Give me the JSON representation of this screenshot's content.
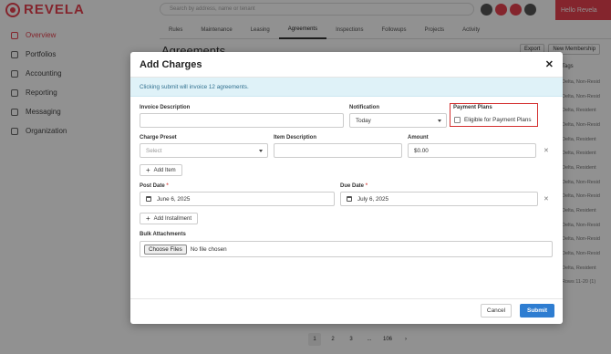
{
  "app": {
    "logo_text": "REVELA",
    "search_placeholder": "Search by address, name or tenant",
    "hello": "Hello Revela"
  },
  "sidebar": {
    "items": [
      {
        "label": "Overview",
        "active": true
      },
      {
        "label": "Portfolios"
      },
      {
        "label": "Accounting"
      },
      {
        "label": "Reporting"
      },
      {
        "label": "Messaging"
      },
      {
        "label": "Organization"
      }
    ]
  },
  "tabs": [
    "Rules",
    "Maintenance",
    "Leasing",
    "Agreements",
    "Inspections",
    "Followups",
    "Projects",
    "Activity"
  ],
  "background": {
    "page_title": "Agreements",
    "btn_export": "Export",
    "btn_new": "New Membership",
    "col_header": "Tags",
    "rows": [
      "Delta, Non-Resid",
      "Delta, Non-Resid",
      "Delta, Resident",
      "Delta, Non-Resid",
      "Delta, Resident",
      "Delta, Resident",
      "Delta, Resident",
      "Delta, Non-Resid",
      "Delta, Non-Resid",
      "Delta, Resident",
      "Delta, Non-Resid",
      "Delta, Non-Resid",
      "Delta, Non-Resid",
      "Delta, Resident"
    ],
    "pager": [
      "1",
      "2",
      "3",
      "...",
      "106"
    ],
    "showing": "Rows 11-20 (1)"
  },
  "modal": {
    "title": "Add Charges",
    "alert": "Clicking submit will invoice 12 agreements.",
    "invoice_description_label": "Invoice Description",
    "invoice_description_value": "",
    "notification_label": "Notification",
    "notification_value": "Today",
    "payment_plans_label": "Payment Plans",
    "payment_plans_checkbox": "Eligible for Payment Plans",
    "charge_preset_label": "Charge Preset",
    "charge_preset_placeholder": "Select",
    "item_description_label": "Item Description",
    "item_description_value": "",
    "amount_label": "Amount",
    "amount_value": "$0.00",
    "add_item": "Add Item",
    "post_date_label": "Post Date",
    "post_date_value": "June 6, 2025",
    "due_date_label": "Due Date",
    "due_date_value": "July 6, 2025",
    "add_installment": "Add Installment",
    "bulk_attachments_label": "Bulk Attachments",
    "choose_files": "Choose Files",
    "no_file": "No file chosen",
    "cancel": "Cancel",
    "submit": "Submit"
  }
}
